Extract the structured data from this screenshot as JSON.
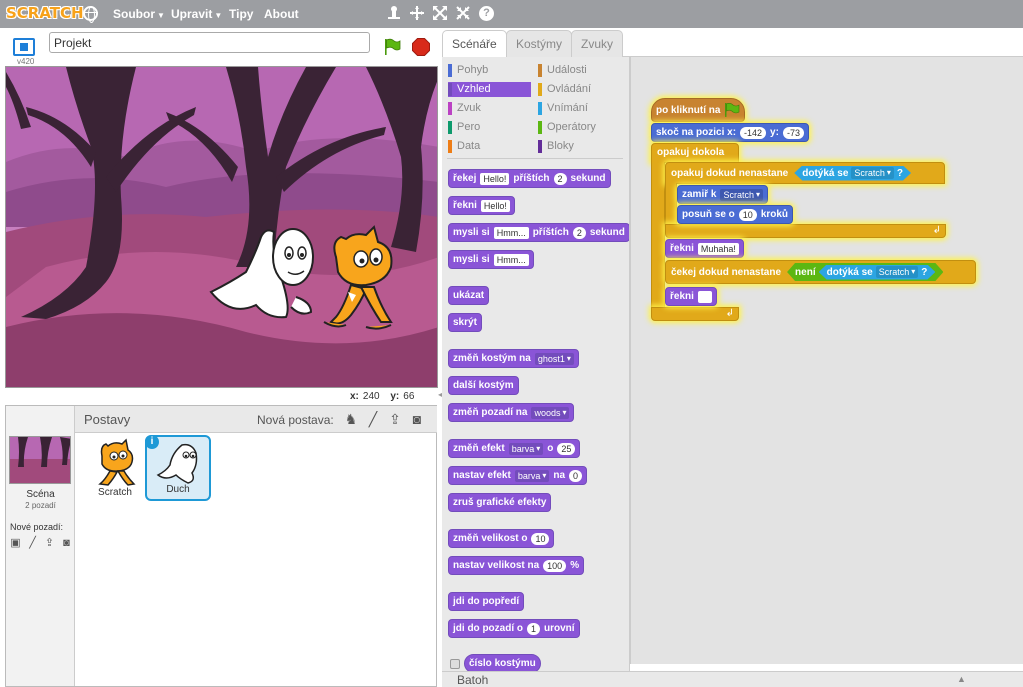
{
  "topbar": {
    "logo": "SCRATCH",
    "menus": [
      {
        "label": "Soubor",
        "has_caret": true
      },
      {
        "label": "Upravit",
        "has_caret": true
      },
      {
        "label": "Tipy",
        "has_caret": false
      },
      {
        "label": "About",
        "has_caret": false
      }
    ],
    "icons": [
      "duplicate-icon",
      "cut-icon",
      "grow-icon",
      "shrink-icon",
      "help-icon"
    ],
    "help_glyph": "?"
  },
  "stage_header": {
    "version": "v420",
    "project_title": "Projekt"
  },
  "stage_info": {
    "x_label": "x:",
    "x_value": "240",
    "y_label": "y:",
    "y_value": "66"
  },
  "sprites_pane": {
    "title": "Postavy",
    "new_sprite_label": "Nová postava:",
    "scene": {
      "label": "Scéna",
      "sub": "2 pozadí",
      "new_bg_label": "Nové pozadí:"
    },
    "sprites": [
      {
        "name": "Scratch",
        "selected": false
      },
      {
        "name": "Duch",
        "selected": true
      }
    ],
    "info_glyph": "i"
  },
  "tabs": [
    {
      "label": "Scénáře",
      "active": true
    },
    {
      "label": "Kostýmy",
      "active": false
    },
    {
      "label": "Zvuky",
      "active": false
    }
  ],
  "categories": [
    {
      "label": "Pohyb",
      "color": "#4a6cd4"
    },
    {
      "label": "Události",
      "color": "#c88330"
    },
    {
      "label": "Vzhled",
      "color": "#8a55d7",
      "selected": true
    },
    {
      "label": "Ovládání",
      "color": "#e1a91a"
    },
    {
      "label": "Zvuk",
      "color": "#bb42c3"
    },
    {
      "label": "Vnímání",
      "color": "#2ca5e2"
    },
    {
      "label": "Pero",
      "color": "#0e9a6c"
    },
    {
      "label": "Operátory",
      "color": "#5cb712"
    },
    {
      "label": "Data",
      "color": "#ee7d16"
    },
    {
      "label": "Bloky",
      "color": "#632d99"
    }
  ],
  "palette": {
    "say_for": {
      "a": "řekej",
      "in": "Hello!",
      "b": "příštích",
      "n": "2",
      "c": "sekund"
    },
    "say": {
      "a": "řekni",
      "in": "Hello!"
    },
    "think_for": {
      "a": "mysli si",
      "in": "Hmm...",
      "b": "příštích",
      "n": "2",
      "c": "sekund"
    },
    "think": {
      "a": "mysli si",
      "in": "Hmm..."
    },
    "show": "ukázat",
    "hide": "skrýt",
    "switch_costume": {
      "a": "změň kostým na",
      "dd": "ghost1"
    },
    "next_costume": "další kostým",
    "switch_bg": {
      "a": "změň pozadí na",
      "dd": "woods"
    },
    "change_effect": {
      "a": "změň efekt",
      "dd": "barva",
      "b": "o",
      "n": "25"
    },
    "set_effect": {
      "a": "nastav efekt",
      "dd": "barva",
      "b": "na",
      "n": "0"
    },
    "clear_effects": "zruš grafické efekty",
    "change_size": {
      "a": "změň velikost o",
      "n": "10"
    },
    "set_size": {
      "a": "nastav velikost na",
      "n": "100",
      "b": "%"
    },
    "front": "jdi do popředí",
    "back": {
      "a": "jdi do pozadí o",
      "n": "1",
      "b": "urovní"
    },
    "costume_num": "číslo kostýmu"
  },
  "script": {
    "hat": "po kliknutí na",
    "goto": {
      "a": "skoč na pozici x:",
      "x": "-142",
      "b": "y:",
      "y": "-73"
    },
    "forever": "opakuj dokola",
    "repeat_until": {
      "a": "opakuj dokud nenastane",
      "touching": "dotýká se",
      "dd": "Scratch",
      "q": "?"
    },
    "point_towards": {
      "a": "zamiř k",
      "dd": "Scratch"
    },
    "move": {
      "a": "posuň se o",
      "n": "10",
      "b": "kroků"
    },
    "say1": {
      "a": "řekni",
      "in": "Muhaha!"
    },
    "wait_until": {
      "a": "čekej dokud nenastane",
      "not": "není",
      "touching": "dotýká se",
      "dd": "Scratch",
      "q": "?"
    },
    "say2": {
      "a": "řekni",
      "in": ""
    }
  },
  "backpack": {
    "label": "Batoh"
  }
}
